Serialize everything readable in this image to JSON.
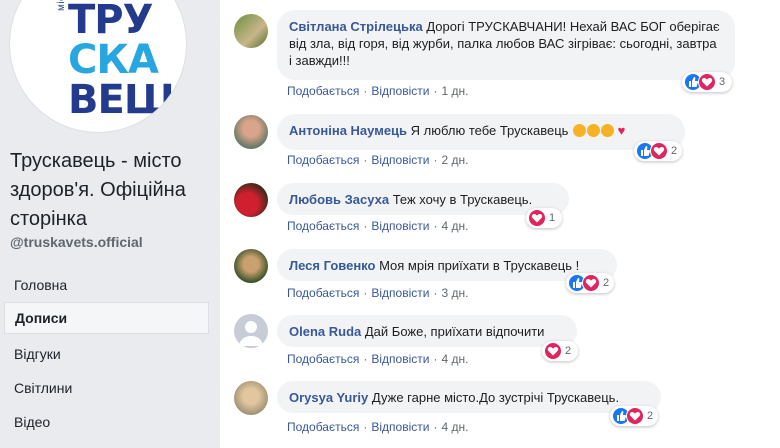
{
  "page": {
    "logo": {
      "side_text": "місто здоров'я",
      "line1": "ТРУ",
      "line2": "СКА",
      "line3": "ВЕЦЬ"
    },
    "name": "Трускавець - місто здоров'я. Офіційна сторінка",
    "handle": "@truskavets.official"
  },
  "nav": [
    {
      "label": "Головна",
      "active": false
    },
    {
      "label": "Дописи",
      "active": true
    },
    {
      "label": "Відгуки",
      "active": false
    },
    {
      "label": "Світлини",
      "active": false
    },
    {
      "label": "Відео",
      "active": false
    }
  ],
  "comments": [
    {
      "author": "Світлана Стрілецька",
      "text": "Дорогі ТРУСКАВЧАНИ! Нехай ВАС БОГ оберігає від зла, від горя, від журби, палка любов ВАС зігріває: сьогодні, завтра і завжди!!!",
      "reactions": "3",
      "time": "1 дн."
    },
    {
      "author": "Антоніна Наумець",
      "text": "Я люблю тебе Трускавець",
      "reactions": "2",
      "time": "2 дн."
    },
    {
      "author": "Любовь Засуха",
      "text": "Теж хочу в Трускавець.",
      "reactions": "1",
      "time": "4 дн."
    },
    {
      "author": "Леся Говенко",
      "text": "Моя мрія приїхати в Трускавець !",
      "reactions": "2",
      "time": "3 дн."
    },
    {
      "author": "Olena Ruda",
      "text": "Дай Боже, приїхати відпочити",
      "reactions": "2",
      "time": "4 дн."
    },
    {
      "author": "Orysya Yuriy",
      "text": "Дуже гарне місто.До зустрічі Трускавець.",
      "reactions": "2",
      "time": "4 дн."
    }
  ],
  "actions": {
    "like": "Подобається",
    "reply": "Відповісти",
    "sep": "·"
  },
  "colors": {
    "link": "#385898",
    "bubble": "#f2f3f5",
    "like": "#1877f2",
    "love": "#e0245e",
    "logo_blue": "#243a8c",
    "logo_accent": "#27a6e0"
  }
}
